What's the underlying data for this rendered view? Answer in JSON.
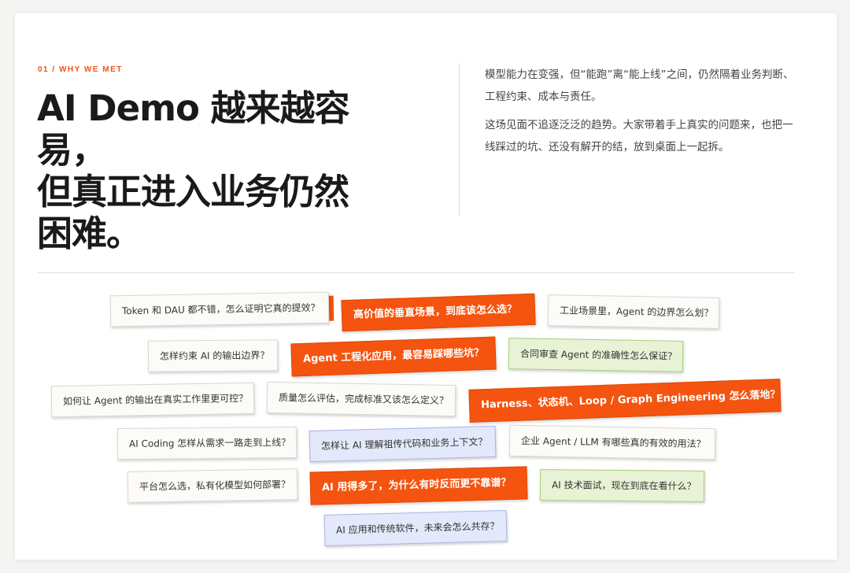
{
  "section": {
    "eyebrow": "01 / WHY WE MET",
    "headline_line1": "AI Demo 越来越容易，",
    "headline_line2": "但真正进入业务仍然",
    "headline_line3": "困难。"
  },
  "intro": {
    "paragraph1": "模型能力在变强，但“能跑”离“能上线”之间，仍然隔着业务判断、工程约束、成本与责任。",
    "paragraph2": "这场见面不追逐泛泛的趋势。大家带着手上真实的问题来，也把一线踩过的坑、还没有解开的结，放到桌面上一起拆。"
  },
  "questions": [
    "Token 和 DAU 都不错，怎么证明它真的提效？",
    "高价值的垂直场景，到底该怎么选？",
    "工业场景里，Agent 的边界怎么划？",
    "怎样约束 AI 的输出边界？",
    "Agent 工程化应用，最容易踩哪些坑？",
    "合同审查 Agent 的准确性怎么保证？",
    "如何让 Agent 的输出在真实工作里更可控？",
    "质量怎么评估，完成标准又该怎么定义？",
    "Harness、状态机、Loop / Graph Engineering 怎么落地？",
    "AI Coding 怎样从需求一路走到上线？",
    "怎样让 AI 理解祖传代码和业务上下文？",
    "企业 Agent / LLM 有哪些真的有效的用法？",
    "平台怎么选，私有化模型如何部署？",
    "AI 用得多了，为什么有时反而更不靠谱？",
    "AI 技术面试，现在到底在看什么？",
    "AI 应用和传统软件，未来会怎么共存？"
  ],
  "colors": {
    "accent": "#f4540f",
    "green_card": "#e7f3d4",
    "blue_card": "#e4e8fb",
    "plain_card": "#fcfbf7"
  }
}
